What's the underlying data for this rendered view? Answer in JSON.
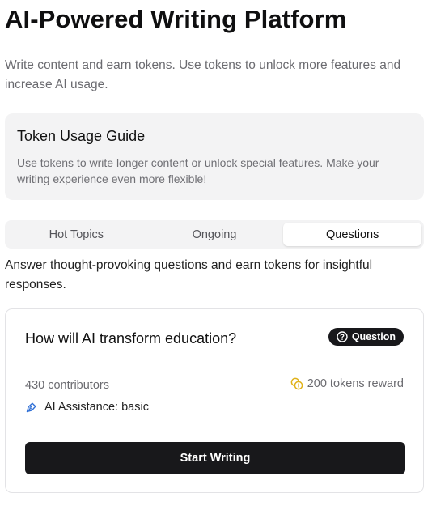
{
  "header": {
    "title": "AI-Powered Writing Platform",
    "subtitle": "Write content and earn tokens. Use tokens to unlock more features and increase AI usage."
  },
  "guide": {
    "title": "Token Usage Guide",
    "text": "Use tokens to write longer content or unlock special features. Make your writing experience even more flexible!"
  },
  "tabs": [
    {
      "label": "Hot Topics",
      "active": false
    },
    {
      "label": "Ongoing",
      "active": false
    },
    {
      "label": "Questions",
      "active": true
    }
  ],
  "tab_description": "Answer thought-provoking questions and earn tokens for insightful responses.",
  "card": {
    "question": "How will AI transform education?",
    "badge": "Question",
    "contributors": "430 contributors",
    "reward": "200 tokens reward",
    "assistance": "AI Assistance: basic",
    "button": "Start Writing",
    "icons": {
      "badge": "question-circle-icon",
      "reward": "coins-icon",
      "assistance": "pen-tool-icon"
    }
  },
  "colors": {
    "accent_dark": "#18181b",
    "panel_bg": "#f3f3f4",
    "coin_yellow": "#e0b21a",
    "pen_blue": "#2f6fd6"
  }
}
